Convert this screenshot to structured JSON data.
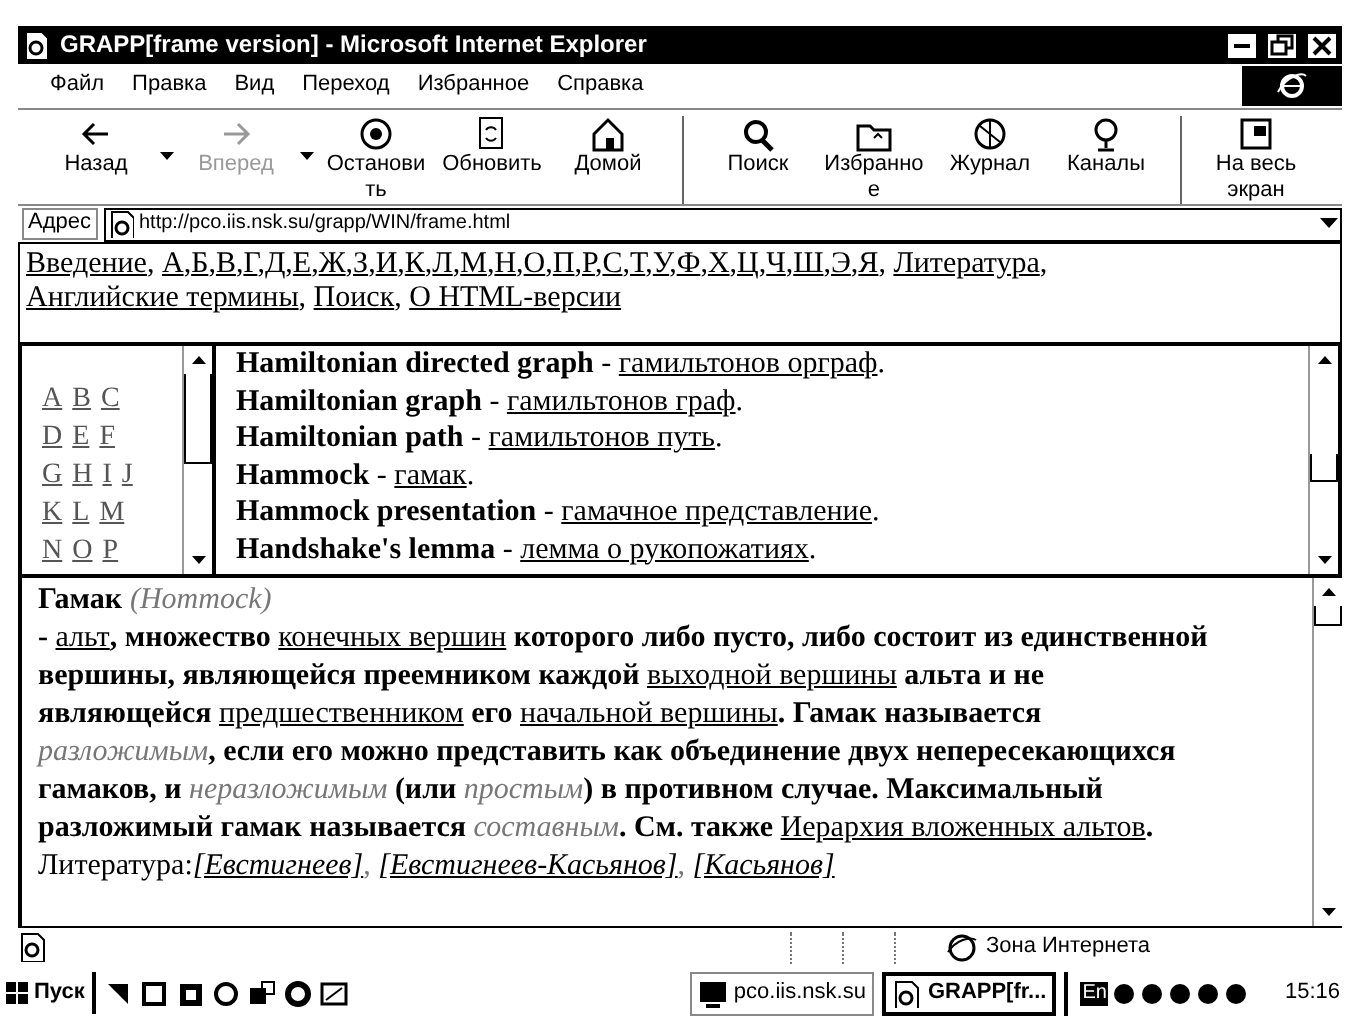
{
  "window": {
    "title": "GRAPP[frame version] - Microsoft Internet Explorer"
  },
  "menu": [
    "Файл",
    "Правка",
    "Вид",
    "Переход",
    "Избранное",
    "Справка"
  ],
  "toolbar": [
    {
      "kind": "button",
      "label_lines": [
        "Назад"
      ],
      "disabled": false
    },
    {
      "kind": "dropdown",
      "disabled": false
    },
    {
      "kind": "button",
      "label_lines": [
        "Вперед"
      ],
      "disabled": true
    },
    {
      "kind": "dropdown",
      "disabled": false
    },
    {
      "kind": "button",
      "label_lines": [
        "Останови",
        "ть"
      ],
      "disabled": false
    },
    {
      "kind": "button",
      "label_lines": [
        "Обновить"
      ],
      "disabled": false
    },
    {
      "kind": "button",
      "label_lines": [
        "Домой"
      ],
      "disabled": false
    },
    {
      "kind": "separator"
    },
    {
      "kind": "button",
      "label_lines": [
        "Поиск"
      ],
      "disabled": false
    },
    {
      "kind": "button",
      "label_lines": [
        "Избранно",
        "е"
      ],
      "disabled": false
    },
    {
      "kind": "button",
      "label_lines": [
        "Журнал"
      ],
      "disabled": false
    },
    {
      "kind": "button",
      "label_lines": [
        "Каналы"
      ],
      "disabled": false
    },
    {
      "kind": "separator"
    },
    {
      "kind": "button",
      "label_lines": [
        "На весь",
        "экран"
      ],
      "disabled": false
    }
  ],
  "address": {
    "label": "Адрес",
    "value": "http://pco.iis.nsk.su/grapp/WIN/frame.html"
  },
  "nav_frame": {
    "links": [
      {
        "text": "Введение",
        "after": ", "
      },
      {
        "text": "А",
        "after": ","
      },
      {
        "text": "Б",
        "after": ","
      },
      {
        "text": "В",
        "after": ","
      },
      {
        "text": "Г",
        "after": ","
      },
      {
        "text": "Д",
        "after": ","
      },
      {
        "text": "Е",
        "after": ","
      },
      {
        "text": "Ж",
        "after": ","
      },
      {
        "text": "З",
        "after": ","
      },
      {
        "text": "И",
        "after": ","
      },
      {
        "text": "К",
        "after": ","
      },
      {
        "text": "Л",
        "after": ","
      },
      {
        "text": "М",
        "after": ","
      },
      {
        "text": "Н",
        "after": ","
      },
      {
        "text": "О",
        "after": ","
      },
      {
        "text": "П",
        "after": ","
      },
      {
        "text": "Р",
        "after": ","
      },
      {
        "text": "С",
        "after": ","
      },
      {
        "text": "Т",
        "after": ","
      },
      {
        "text": "У",
        "after": ","
      },
      {
        "text": "Ф",
        "after": ","
      },
      {
        "text": "Х",
        "after": ","
      },
      {
        "text": "Ц",
        "after": ","
      },
      {
        "text": "Ч",
        "after": ","
      },
      {
        "text": "Ш",
        "after": ","
      },
      {
        "text": "Э",
        "after": ","
      },
      {
        "text": "Я",
        "after": ", "
      },
      {
        "text": "Литература",
        "after": ", "
      },
      {
        "text": "Английские термины",
        "after": ", "
      },
      {
        "text": "Поиск",
        "after": ", "
      },
      {
        "text": "О HTML-версии"
      }
    ]
  },
  "letters_frame": {
    "rows": [
      [
        "A",
        "B",
        "C"
      ],
      [
        "D",
        "E",
        "F"
      ],
      [
        "G",
        "H",
        "I",
        "J"
      ],
      [
        "K",
        "L",
        "M"
      ],
      [
        "N",
        "O",
        "P"
      ]
    ]
  },
  "terms_frame": {
    "separator": " - ",
    "end": ".",
    "rows": [
      {
        "term": "Hamiltonian directed graph",
        "translation": "гамильтонов орграф"
      },
      {
        "term": "Hamiltonian graph",
        "translation": "гамильтонов граф"
      },
      {
        "term": "Hamiltonian path",
        "translation": "гамильтонов путь"
      },
      {
        "term": "Hammock",
        "translation": "гамак"
      },
      {
        "term": "Hammock presentation",
        "translation": "гамачное представление"
      },
      {
        "term": "Handshake's lemma",
        "translation": "лемма о рукопожатиях"
      }
    ]
  },
  "article": {
    "title": "Гамак",
    "subtitle": "(Hommock)",
    "segments": [
      {
        "kind": "text",
        "text": "- "
      },
      {
        "kind": "link",
        "text": "альт"
      },
      {
        "kind": "text",
        "text": ", множество "
      },
      {
        "kind": "link",
        "text": "конечных вершин"
      },
      {
        "kind": "text",
        "text": " которого либо пусто, либо состоит из единственной вершины, являющейся преемником каждой "
      },
      {
        "kind": "link",
        "text": "выходной вершины"
      },
      {
        "kind": "text",
        "text": " альта и не являющейся "
      },
      {
        "kind": "link",
        "text": "предшественником"
      },
      {
        "kind": "text",
        "text": " его "
      },
      {
        "kind": "link",
        "text": "начальной вершины"
      },
      {
        "kind": "text",
        "text": ". Гамак называется "
      },
      {
        "kind": "italic",
        "text": "разложимым"
      },
      {
        "kind": "text",
        "text": ", если его можно представить как объединение двух непересекающихся гамаков, и "
      },
      {
        "kind": "italic",
        "text": "неразложимым"
      },
      {
        "kind": "text",
        "text": " (или "
      },
      {
        "kind": "italic",
        "text": "простым"
      },
      {
        "kind": "text",
        "text": ") в противном случае. Максимальный разложимый гамак называется "
      },
      {
        "kind": "italic",
        "text": "составным"
      },
      {
        "kind": "text",
        "text": ". См. также "
      },
      {
        "kind": "link",
        "text": "Иерархия вложенных альтов"
      },
      {
        "kind": "text",
        "text": "."
      }
    ],
    "references_label": "Литература:",
    "references": [
      {
        "text": "[Евстигнеев]",
        "after": ", "
      },
      {
        "text": "[Евстигнеев-Касьянов]",
        "after": ", "
      },
      {
        "text": "[Касьянов]"
      }
    ]
  },
  "status_bar": {
    "zone": "Зона Интернета"
  },
  "taskbar": {
    "start": "Пуск",
    "tasks": [
      {
        "label": "pco.iis.nsk.su",
        "selected": false
      },
      {
        "label": "GRAPP[fr...",
        "selected": true
      }
    ],
    "language": "En",
    "clock": "15:16"
  }
}
